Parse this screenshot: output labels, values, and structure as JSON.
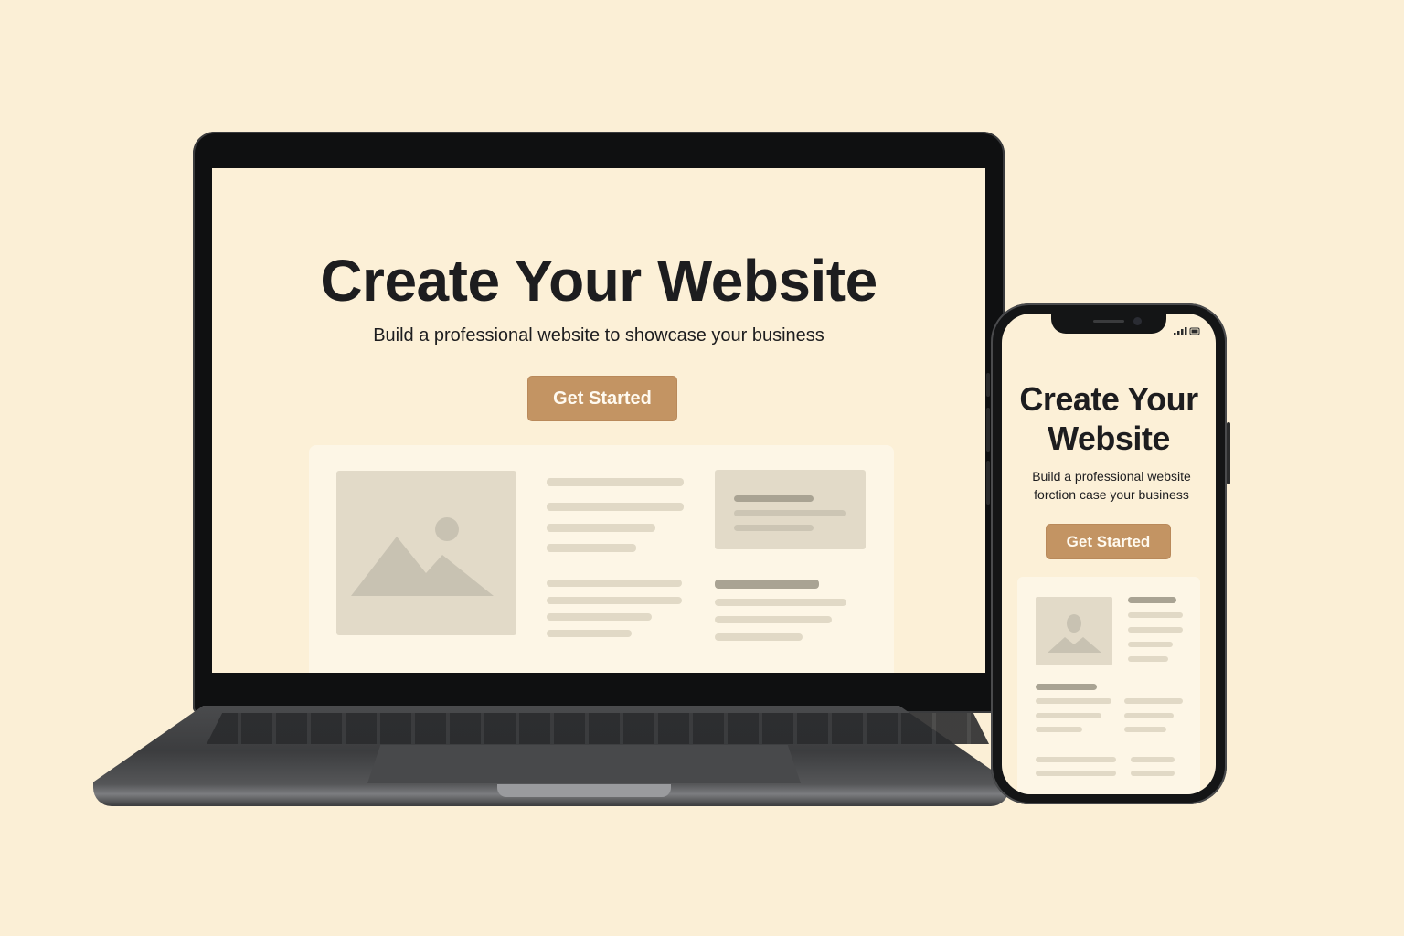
{
  "laptop": {
    "headline": "Create Your Website",
    "subheadline": "Build a professional website to showcase your business",
    "cta_label": "Get Started"
  },
  "phone": {
    "headline_line1": "Create Your",
    "headline_line2": "Website",
    "subheadline_line1": "Build a professional website",
    "subheadline_line2": "forction case your business",
    "cta_label": "Get Started"
  },
  "colors": {
    "background": "#fbefd6",
    "screen": "#fcf0d7",
    "accent_button": "#c39463",
    "placeholder": "#e2dac8",
    "text": "#1d1d1f"
  },
  "icons": {
    "image_placeholder": "image-placeholder-icon",
    "user_placeholder": "user-placeholder-icon",
    "signal": "signal-icon"
  }
}
